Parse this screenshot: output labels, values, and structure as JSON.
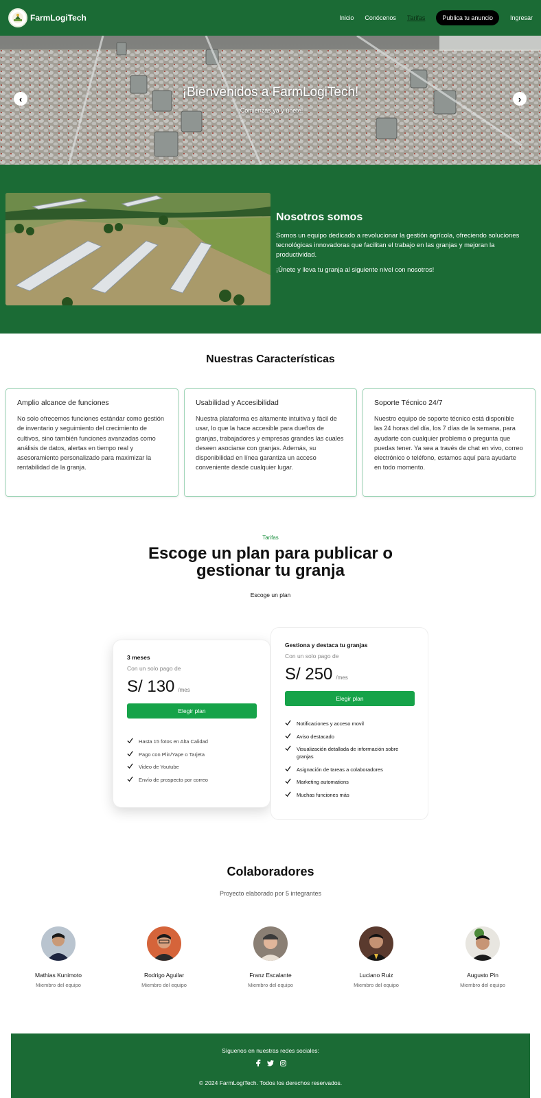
{
  "nav": {
    "brand": "FarmLogiTech",
    "links": [
      "Inicio",
      "Conócenos",
      "Tarifas"
    ],
    "cta": "Publica tu anuncio",
    "login": "Ingresar"
  },
  "hero": {
    "title": "¡Bienvenidos a FarmLogiTech!",
    "subtitle": "¡Comienzas ya y únete!",
    "prev": "‹",
    "next": "›"
  },
  "about": {
    "title": "Nosotros somos",
    "p1": "Somos un equipo dedicado a revolucionar la gestión agrícola, ofreciendo soluciones tecnológicas innovadoras que facilitan el trabajo en las granjas y mejoran la productividad.",
    "p2": "¡Únete y lleva tu granja al siguiente nivel con nosotros!"
  },
  "features": {
    "title": "Nuestras Características",
    "cards": [
      {
        "title": "Amplio alcance de funciones",
        "text": "No solo ofrecemos funciones estándar como gestión de inventario y seguimiento del crecimiento de cultivos, sino también funciones avanzadas como análisis de datos, alertas en tiempo real y asesoramiento personalizado para maximizar la rentabilidad de la granja."
      },
      {
        "title": "Usabilidad y Accesibilidad",
        "text": "Nuestra plataforma es altamente intuitiva y fácil de usar, lo que la hace accesible para dueños de granjas, trabajadores y empresas grandes las cuales deseen asociarse con granjas. Además, su disponibilidad en línea garantiza un acceso conveniente desde cualquier lugar."
      },
      {
        "title": "Soporte Técnico 24/7",
        "text": "Nuestro equipo de soporte técnico está disponible las 24 horas del día, los 7 días de la semana, para ayudarte con cualquier problema o pregunta que puedas tener. Ya sea a través de chat en vivo, correo electrónico o teléfono, estamos aquí para ayudarte en todo momento."
      }
    ]
  },
  "pricing": {
    "label": "Tarifas",
    "title": "Escoge un plan para publicar o gestionar tu granja",
    "subtitle": "Escoge un plan",
    "plans": [
      {
        "name": "3 meses",
        "note": "Con un solo pago de",
        "price": "S/ 130",
        "period": "/mes",
        "button": "Elegir plan",
        "features": [
          "Hasta 15 fotos en Alta Calidad",
          "Pago con Plin/Yape o Tarjeta",
          "Video de Youtube",
          "Envío de prospecto por correo"
        ]
      },
      {
        "name": "Gestiona y destaca tu granjas",
        "note": "Con un solo pago de",
        "price": "S/ 250",
        "period": "/mes",
        "button": "Elegir plan",
        "features": [
          "Notificaciones y acceso movil",
          "Aviso destacado",
          "Visualización detallada de información sobre granjas",
          "Asignación de tareas a colaboradores",
          "Marketing automations",
          "Muchas funciones más"
        ]
      }
    ]
  },
  "team": {
    "title": "Colaboradores",
    "subtitle": "Proyecto elaborado por 5 integrantes",
    "members": [
      {
        "name": "Mathias Kunimoto",
        "role": "Miembro del equipo"
      },
      {
        "name": "Rodrigo Aguilar",
        "role": "Miembro del equipo"
      },
      {
        "name": "Franz Escalante",
        "role": "Miembro del equipo"
      },
      {
        "name": "Luciano Ruiz",
        "role": "Miembro del equipo"
      },
      {
        "name": "Augusto Pin",
        "role": "Miembro del equipo"
      }
    ]
  },
  "footer": {
    "social_label": "Síguenos en nuestras redes sociales:",
    "social_icons": [
      "facebook-icon",
      "twitter-icon",
      "instagram-icon"
    ],
    "copyright": "© 2024 FarmLogiTech. Todos los derechos reservados."
  },
  "colors": {
    "brand_green": "#1b6b35",
    "button_green": "#16a349",
    "label_green": "#1a8f3e",
    "card_border": "#9ed4b7"
  }
}
